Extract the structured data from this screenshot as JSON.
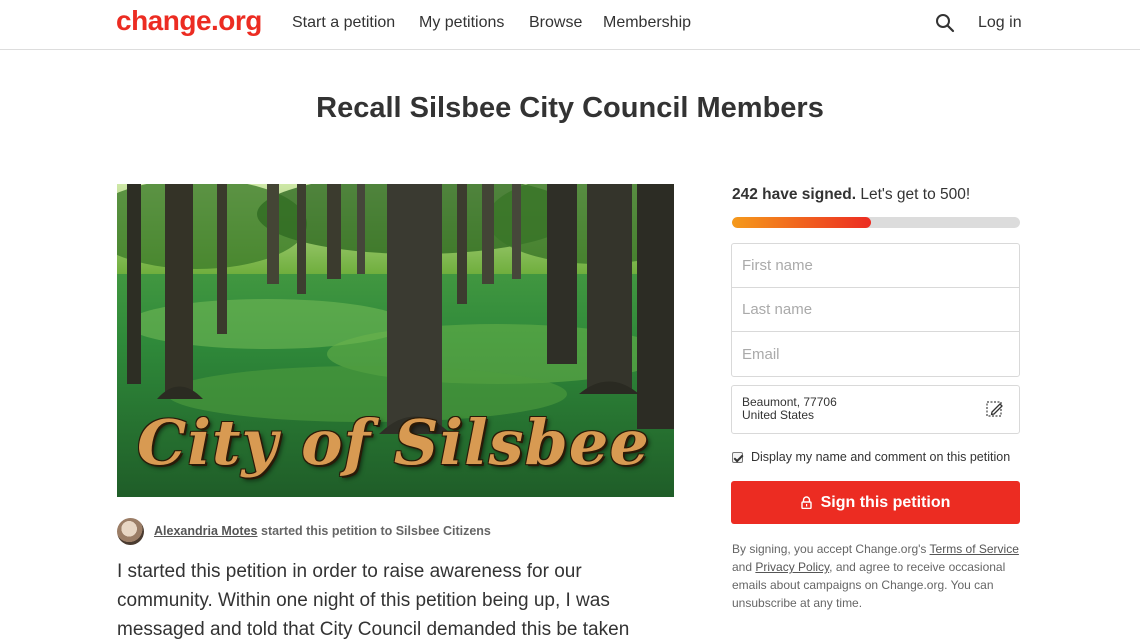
{
  "header": {
    "logo": "change.org",
    "nav": {
      "start": "Start a petition",
      "my": "My petitions",
      "browse": "Browse",
      "membership": "Membership"
    },
    "search_icon": "search-icon",
    "login": "Log in"
  },
  "petition": {
    "title": "Recall Silsbee City Council Members",
    "image_caption": "City of Silsbee",
    "author_name": "Alexandria Motes",
    "author_suffix": " started this petition to Silsbee Citizens",
    "body": "I started this petition in order to raise awareness for our community. Within one night of this petition being up, I was messaged and told that City Council demanded this be taken"
  },
  "sidebar": {
    "signed_count": "242 have signed.",
    "goal_text": " Let's get to 500!",
    "progress_fraction": 0.484,
    "fields": {
      "first_name": "First name",
      "last_name": "Last name",
      "email": "Email"
    },
    "location_line1": "Beaumont, 77706",
    "location_line2": "United States",
    "display_checkbox_label": "Display my name and comment on this petition",
    "display_checked": true,
    "sign_button": "Sign this petition",
    "legal": {
      "p1": "By signing, you accept Change.org's ",
      "terms": "Terms of Service",
      "p2": " and ",
      "privacy": "Privacy Policy",
      "p3": ", and agree to receive occasional emails about campaigns on Change.org. You can unsubscribe at any time."
    }
  },
  "colors": {
    "brand": "#ec2c22",
    "progress_start": "#f59a1b",
    "progress_end": "#ec2c22"
  }
}
